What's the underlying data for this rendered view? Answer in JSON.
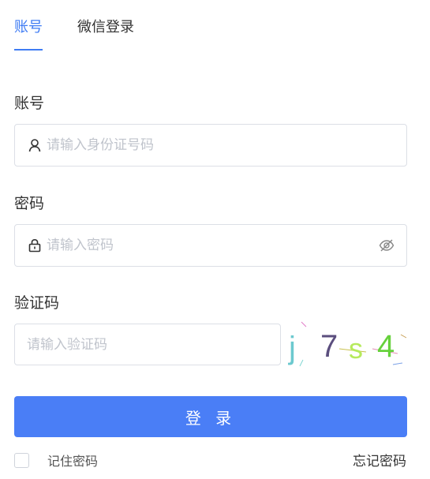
{
  "tabs": [
    {
      "label": "账号",
      "active": true
    },
    {
      "label": "微信登录",
      "active": false
    }
  ],
  "account": {
    "label": "账号",
    "placeholder": "请输入身份证号码",
    "value": ""
  },
  "password": {
    "label": "密码",
    "placeholder": "请输入密码",
    "value": ""
  },
  "captcha": {
    "label": "验证码",
    "placeholder": "请输入验证码",
    "value": "",
    "chars": [
      {
        "char": "j",
        "color": "#6cc9cf"
      },
      {
        "char": "7",
        "color": "#5b4e7e"
      },
      {
        "char": "s",
        "color": "#b6ea5c"
      },
      {
        "char": "4",
        "color": "#66d13c"
      }
    ]
  },
  "login_button": "登 录",
  "remember_label": "记住密码",
  "forgot_link": "忘记密码",
  "colors": {
    "accent": "#3f7cf4",
    "button": "#4a7ef6"
  },
  "icons": {
    "account": "user-icon",
    "password": "lock-icon",
    "toggle": "eye-off-icon"
  }
}
